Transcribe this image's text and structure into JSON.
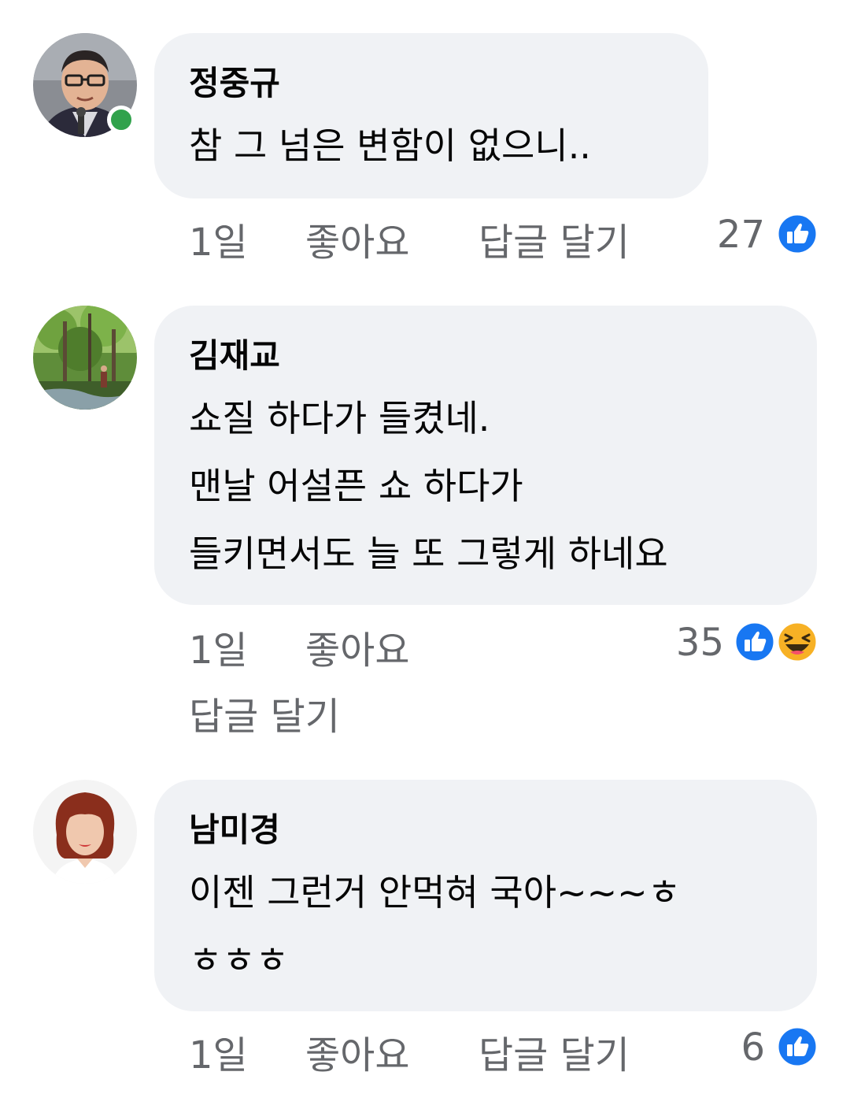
{
  "comments": [
    {
      "author": "정중규",
      "online": true,
      "lines": [
        "참 그 넘은 변함이 없으니.."
      ],
      "time": "1일",
      "like_label": "좋아요",
      "reply_label": "답글 달기",
      "reaction_count": "27",
      "reactions": [
        "like-icon"
      ]
    },
    {
      "author": "김재교",
      "online": false,
      "lines": [
        "쇼질 하다가 들켰네.",
        "맨날 어설픈 쇼 하다가",
        "들키면서도 늘 또 그렇게 하네요"
      ],
      "time": "1일",
      "like_label": "좋아요",
      "reply_label": "답글 달기",
      "reaction_count": "35",
      "reactions": [
        "like-icon",
        "haha-icon"
      ]
    },
    {
      "author": "남미경",
      "online": false,
      "lines": [
        "이젠 그런거 안먹혀 국아~~~ㅎ",
        "ㅎㅎㅎ"
      ],
      "time": "1일",
      "like_label": "좋아요",
      "reply_label": "답글 달기",
      "reaction_count": "6",
      "reactions": [
        "like-icon"
      ]
    }
  ],
  "colors": {
    "bubble_bg": "#f0f2f5",
    "meta_text": "#65676b",
    "like_blue": "#1877f2",
    "online_green": "#31a24c",
    "haha_yellow": "#f7b125"
  }
}
